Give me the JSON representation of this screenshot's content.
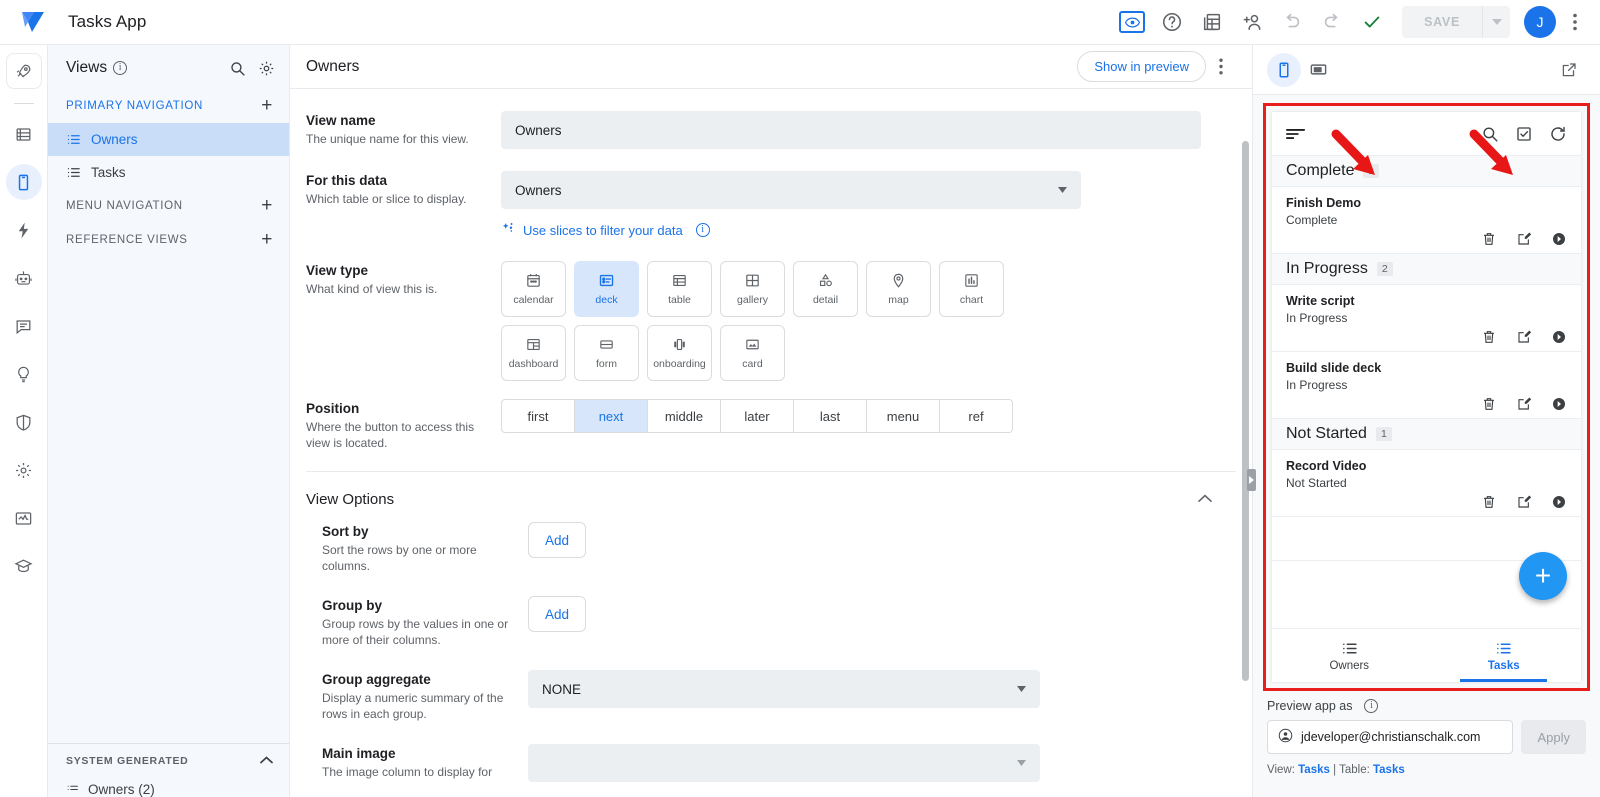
{
  "topbar": {
    "app_title": "Tasks App",
    "logo_name": "appsheet-logo",
    "icons": [
      {
        "name": "preview-eye-icon",
        "glyph": "eye",
        "active": true
      },
      {
        "name": "help-icon",
        "glyph": "help"
      },
      {
        "name": "data-tables-icon",
        "glyph": "tables"
      },
      {
        "name": "add-collaborator-icon",
        "glyph": "person-add"
      },
      {
        "name": "undo-icon",
        "glyph": "undo"
      },
      {
        "name": "redo-icon",
        "glyph": "redo"
      },
      {
        "name": "checkmark-icon",
        "glyph": "check"
      }
    ],
    "save_label": "SAVE",
    "save_enabled": false,
    "avatar_initial": "J",
    "kebab_name": "more-options-icon",
    "accent_color": "#1a73e8",
    "check_color": "#188038"
  },
  "rail": {
    "items": [
      {
        "name": "rail-item-quickstart",
        "icon": "rocket-icon",
        "active": false,
        "boxed": true
      },
      {
        "name": "rail-item-data",
        "icon": "database-icon",
        "active": false
      },
      {
        "name": "rail-item-app",
        "icon": "mobile-icon",
        "active": true
      },
      {
        "name": "rail-item-automation",
        "icon": "bolt-icon",
        "active": false
      },
      {
        "name": "rail-item-agents",
        "icon": "robot-icon",
        "active": false
      },
      {
        "name": "rail-item-chat",
        "icon": "chat-icon",
        "active": false
      },
      {
        "name": "rail-item-intelligence",
        "icon": "lightbulb-icon",
        "active": false
      },
      {
        "name": "rail-item-security",
        "icon": "shield-icon",
        "active": false
      },
      {
        "name": "rail-item-settings",
        "icon": "gear-icon",
        "active": false
      },
      {
        "name": "rail-item-monitor",
        "icon": "monitor-icon",
        "active": false
      },
      {
        "name": "rail-item-learn",
        "icon": "graduation-cap-icon",
        "active": false
      }
    ]
  },
  "sidebar": {
    "title": "Views",
    "search_icon": "search-icon",
    "settings_icon": "gear-icon",
    "sections": [
      {
        "label": "PRIMARY NAVIGATION",
        "highlight": true,
        "add_label": "+",
        "items": [
          {
            "label": "Owners",
            "icon": "list-icon",
            "selected": true
          },
          {
            "label": "Tasks",
            "icon": "list-icon",
            "selected": false
          }
        ]
      },
      {
        "label": "MENU NAVIGATION",
        "highlight": false,
        "add_label": "+",
        "items": []
      },
      {
        "label": "REFERENCE VIEWS",
        "highlight": false,
        "add_label": "+",
        "items": []
      }
    ],
    "system_generated": {
      "label": "SYSTEM GENERATED",
      "item_label": "Owners (2)"
    }
  },
  "main": {
    "title": "Owners",
    "show_in_preview_label": "Show in preview",
    "kebab_name": "view-more-options-icon",
    "fields": {
      "view_name": {
        "label": "View name",
        "hint": "The unique name for this view.",
        "value": "Owners"
      },
      "for_this_data": {
        "label": "For this data",
        "hint": "Which table or slice to display.",
        "value": "Owners",
        "slices_link": "Use slices to filter your data"
      },
      "view_type": {
        "label": "View type",
        "hint": "What kind of view this is.",
        "selected": "deck",
        "options": [
          {
            "label": "calendar",
            "icon": "calendar-icon"
          },
          {
            "label": "deck",
            "icon": "deck-icon"
          },
          {
            "label": "table",
            "icon": "table-icon"
          },
          {
            "label": "gallery",
            "icon": "gallery-icon"
          },
          {
            "label": "detail",
            "icon": "detail-icon"
          },
          {
            "label": "map",
            "icon": "map-pin-icon"
          },
          {
            "label": "chart",
            "icon": "chart-icon"
          },
          {
            "label": "dashboard",
            "icon": "dashboard-icon"
          },
          {
            "label": "form",
            "icon": "form-icon"
          },
          {
            "label": "onboarding",
            "icon": "onboarding-icon"
          },
          {
            "label": "card",
            "icon": "card-icon"
          }
        ]
      },
      "position": {
        "label": "Position",
        "hint": "Where the button to access this view is located.",
        "selected": "next",
        "options": [
          "first",
          "next",
          "middle",
          "later",
          "last",
          "menu",
          "ref"
        ]
      }
    },
    "view_options": {
      "title": "View Options",
      "collapsed": false,
      "sort_by": {
        "label": "Sort by",
        "hint": "Sort the rows by one or more columns.",
        "add_label": "Add"
      },
      "group_by": {
        "label": "Group by",
        "hint": "Group rows by the values in one or more of their columns.",
        "add_label": "Add"
      },
      "group_aggregate": {
        "label": "Group aggregate",
        "hint": "Display a numeric summary of the rows in each group.",
        "value": "NONE"
      },
      "main_image": {
        "label": "Main image",
        "hint": "The image column to display for",
        "value": ""
      }
    }
  },
  "preview": {
    "device_tabs": [
      {
        "name": "preview-phone-tab",
        "icon": "mobile-icon",
        "active": true
      },
      {
        "name": "preview-tablet-tab",
        "icon": "tablet-icon",
        "active": false
      }
    ],
    "open_external_icon": "open-in-new-icon",
    "app_bar": {
      "menu_icon": "sort-lines-icon",
      "actions": [
        {
          "name": "search-icon"
        },
        {
          "name": "checkbox-icon"
        },
        {
          "name": "refresh-icon"
        }
      ]
    },
    "groups": [
      {
        "name": "Complete",
        "count": "1",
        "tasks": [
          {
            "title": "Finish Demo",
            "status": "Complete"
          }
        ]
      },
      {
        "name": "In Progress",
        "count": "2",
        "tasks": [
          {
            "title": "Write script",
            "status": "In Progress"
          },
          {
            "title": "Build slide deck",
            "status": "In Progress"
          }
        ]
      },
      {
        "name": "Not Started",
        "count": "1",
        "tasks": [
          {
            "title": "Record Video",
            "status": "Not Started"
          }
        ]
      }
    ],
    "row_actions": [
      {
        "name": "delete-icon"
      },
      {
        "name": "edit-icon"
      },
      {
        "name": "open-detail-icon"
      }
    ],
    "fab_label": "+",
    "bottom_nav": [
      {
        "label": "Owners",
        "icon": "list-icon",
        "selected": false
      },
      {
        "label": "Tasks",
        "icon": "list-icon",
        "selected": true
      }
    ],
    "footer": {
      "preview_as_label": "Preview app as",
      "user_email": "jdeveloper@christianschalk.com",
      "apply_label": "Apply",
      "meta_view_prefix": "View:",
      "meta_view_value": "Tasks",
      "meta_sep": "|",
      "meta_table_prefix": "Table:",
      "meta_table_value": "Tasks"
    },
    "highlight_color": "#ea1d1d",
    "arrow_color": "#e81717"
  }
}
